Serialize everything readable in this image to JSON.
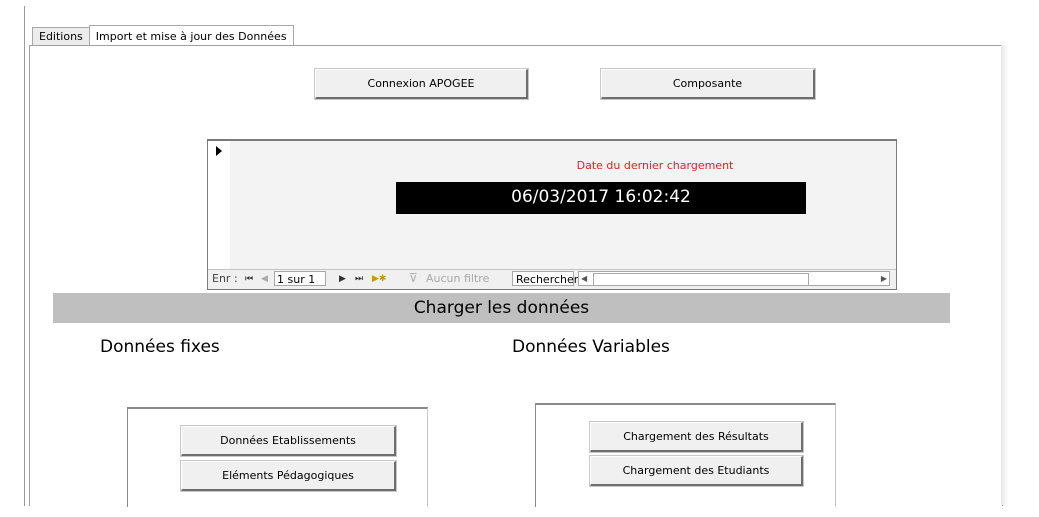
{
  "tabs": [
    {
      "label": "Editions"
    },
    {
      "label": "Import et mise à jour des Données"
    }
  ],
  "top_buttons": {
    "connexion": "Connexion APOGEE",
    "composante": "Composante"
  },
  "subform": {
    "label": "Date du dernier chargement",
    "value": "06/03/2017 16:02:42",
    "label_color": "#e2231a"
  },
  "navigation": {
    "prefix": "Enr :",
    "record": "1 sur 1",
    "filter": "Aucun filtre",
    "search": "Rechercher"
  },
  "banner": {
    "label": "Charger les données"
  },
  "fixed": {
    "title": "Données fixes",
    "buttons": [
      "Données Etablissements",
      "Eléments Pédagogiques"
    ]
  },
  "variable": {
    "title": "Données Variables",
    "buttons": [
      "Chargement des Résultats",
      "Chargement des Etudiants"
    ]
  }
}
